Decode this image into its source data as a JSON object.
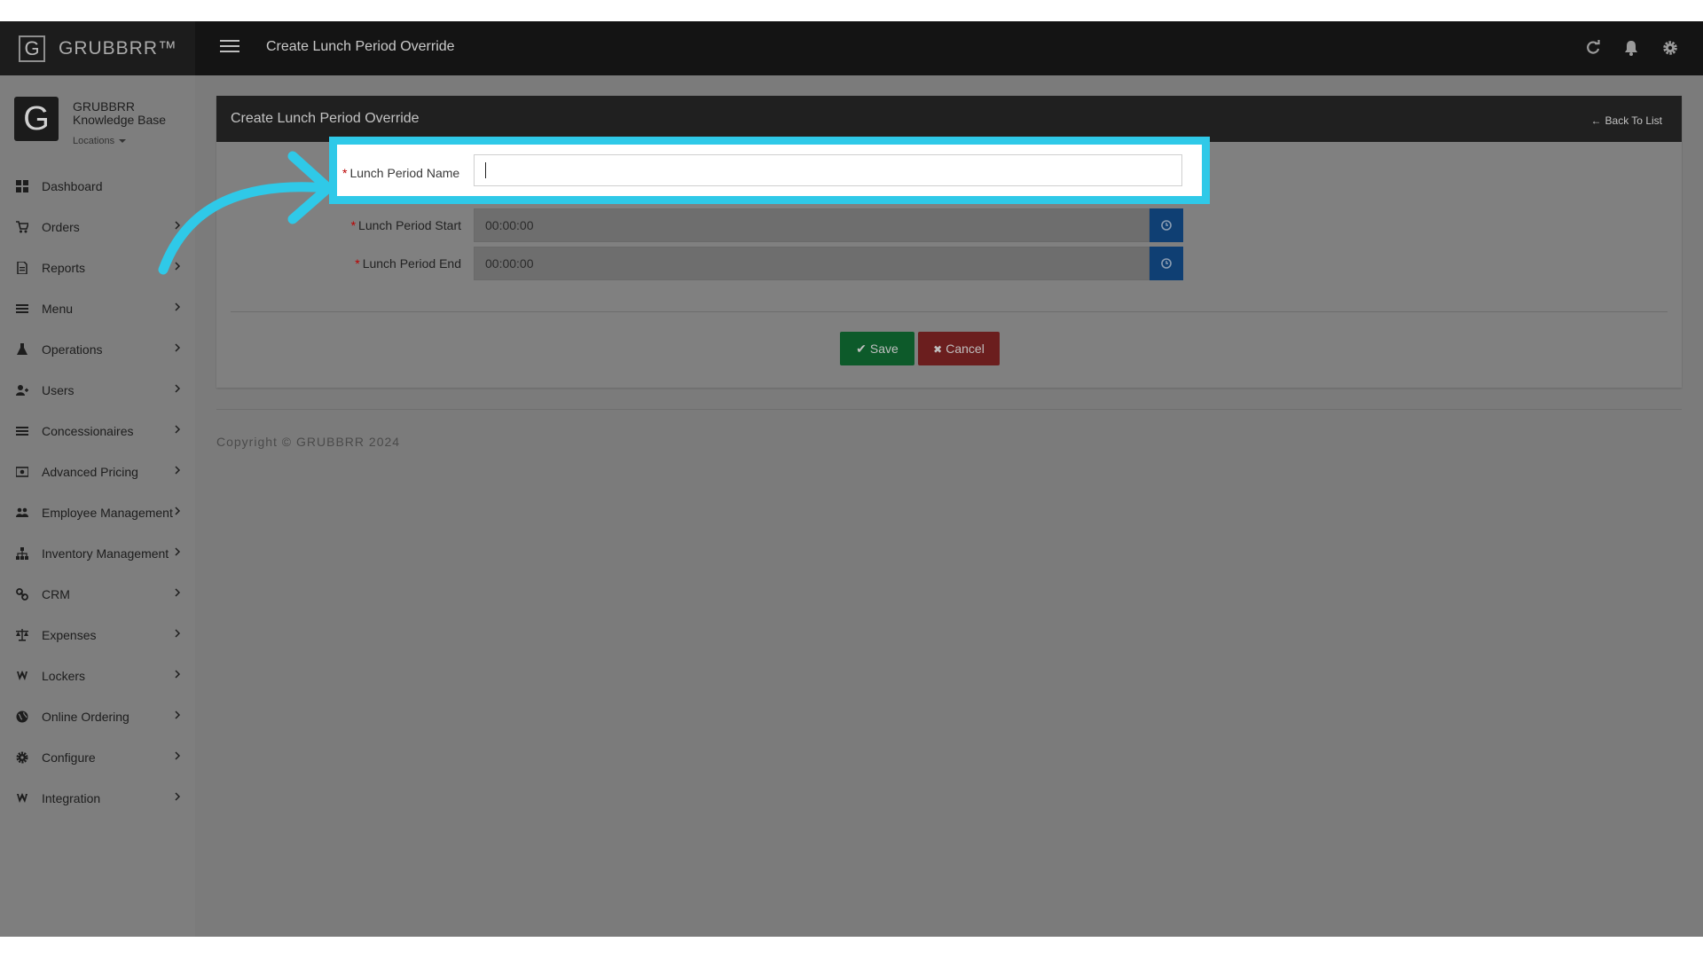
{
  "topbar": {
    "brand": "GRUBBRR™",
    "brand_mark": "G",
    "page_title": "Create Lunch Period Override",
    "icons": [
      "refresh-icon",
      "bell-icon",
      "gear-icon"
    ]
  },
  "sidebar": {
    "avatar_letter": "G",
    "org_name": "GRUBBRR Knowledge Base",
    "locations_label": "Locations",
    "items": [
      {
        "label": "Dashboard",
        "icon": "dashboard-icon",
        "has_submenu": false
      },
      {
        "label": "Orders",
        "icon": "cart-icon",
        "has_submenu": true
      },
      {
        "label": "Reports",
        "icon": "report-icon",
        "has_submenu": true
      },
      {
        "label": "Menu",
        "icon": "menu-list-icon",
        "has_submenu": true
      },
      {
        "label": "Operations",
        "icon": "flask-icon",
        "has_submenu": true
      },
      {
        "label": "Users",
        "icon": "user-add-icon",
        "has_submenu": true
      },
      {
        "label": "Concessionaires",
        "icon": "list-icon",
        "has_submenu": true
      },
      {
        "label": "Advanced Pricing",
        "icon": "money-icon",
        "has_submenu": true
      },
      {
        "label": "Employee Management",
        "icon": "users-icon",
        "has_submenu": true
      },
      {
        "label": "Inventory Management",
        "icon": "sitemap-icon",
        "has_submenu": true
      },
      {
        "label": "CRM",
        "icon": "link-icon",
        "has_submenu": true
      },
      {
        "label": "Expenses",
        "icon": "scale-icon",
        "has_submenu": true
      },
      {
        "label": "Lockers",
        "icon": "lockers-icon",
        "has_submenu": true
      },
      {
        "label": "Online Ordering",
        "icon": "globe-icon",
        "has_submenu": true
      },
      {
        "label": "Configure",
        "icon": "cog-icon",
        "has_submenu": true
      },
      {
        "label": "Integration",
        "icon": "integration-icon",
        "has_submenu": true
      }
    ]
  },
  "panel": {
    "title": "Create Lunch Period Override",
    "back_link": "Back To List",
    "fields": {
      "name": {
        "label": "Lunch Period Name",
        "value": "",
        "required": true
      },
      "start": {
        "label": "Lunch Period Start",
        "value": "00:00:00",
        "required": true,
        "icon": "clock-icon"
      },
      "end": {
        "label": "Lunch Period End",
        "value": "00:00:00",
        "required": true,
        "icon": "clock-icon"
      }
    },
    "save_label": "Save",
    "cancel_label": "Cancel"
  },
  "footer": {
    "copyright": "Copyright © GRUBBRR 2024"
  },
  "colors": {
    "highlight": "#2fc9e8",
    "save": "#1a9e4a",
    "cancel": "#d9534f",
    "clock_button": "#1c6fc4",
    "topbar": "#141414"
  }
}
